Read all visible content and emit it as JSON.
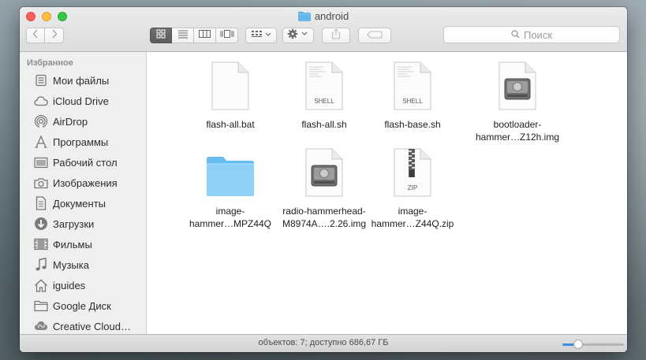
{
  "window": {
    "title": "android"
  },
  "search": {
    "placeholder": "Поиск"
  },
  "toolbar": {
    "views": [
      "icon-view",
      "list-view",
      "column-view",
      "coverflow-view"
    ],
    "active_view": 0
  },
  "sidebar": {
    "section": "Избранное",
    "items": [
      {
        "label": "Мои файлы",
        "icon": "all-files-icon"
      },
      {
        "label": "iCloud Drive",
        "icon": "cloud-icon"
      },
      {
        "label": "AirDrop",
        "icon": "airdrop-icon"
      },
      {
        "label": "Программы",
        "icon": "applications-icon"
      },
      {
        "label": "Рабочий стол",
        "icon": "desktop-icon"
      },
      {
        "label": "Изображения",
        "icon": "camera-icon"
      },
      {
        "label": "Документы",
        "icon": "document-icon"
      },
      {
        "label": "Загрузки",
        "icon": "download-icon"
      },
      {
        "label": "Фильмы",
        "icon": "film-icon"
      },
      {
        "label": "Музыка",
        "icon": "music-note-icon"
      },
      {
        "label": "iguides",
        "icon": "home-icon"
      },
      {
        "label": "Google Диск",
        "icon": "folder-icon"
      },
      {
        "label": "Creative Cloud…",
        "icon": "creative-cloud-icon"
      }
    ]
  },
  "files": [
    {
      "line1": "flash-all.bat",
      "line2": "",
      "kind": "blank-document",
      "badge": ""
    },
    {
      "line1": "flash-all.sh",
      "line2": "",
      "kind": "shell-document",
      "badge": "SHELL"
    },
    {
      "line1": "flash-base.sh",
      "line2": "",
      "kind": "shell-document",
      "badge": "SHELL"
    },
    {
      "line1": "bootloader-",
      "line2": "hammer…Z12h.img",
      "kind": "disk-image",
      "badge": ""
    },
    {
      "line1": "image-",
      "line2": "hammer…MPZ44Q",
      "kind": "folder",
      "badge": ""
    },
    {
      "line1": "radio-hammerhead-",
      "line2": "M8974A….2.26.img",
      "kind": "disk-image",
      "badge": ""
    },
    {
      "line1": "image-",
      "line2": "hammer…Z44Q.zip",
      "kind": "zip-archive",
      "badge": "ZIP"
    }
  ],
  "status": {
    "text": "объектов: 7; доступно 686,67 ГБ"
  },
  "icon_size_slider": {
    "value": 0.25
  }
}
